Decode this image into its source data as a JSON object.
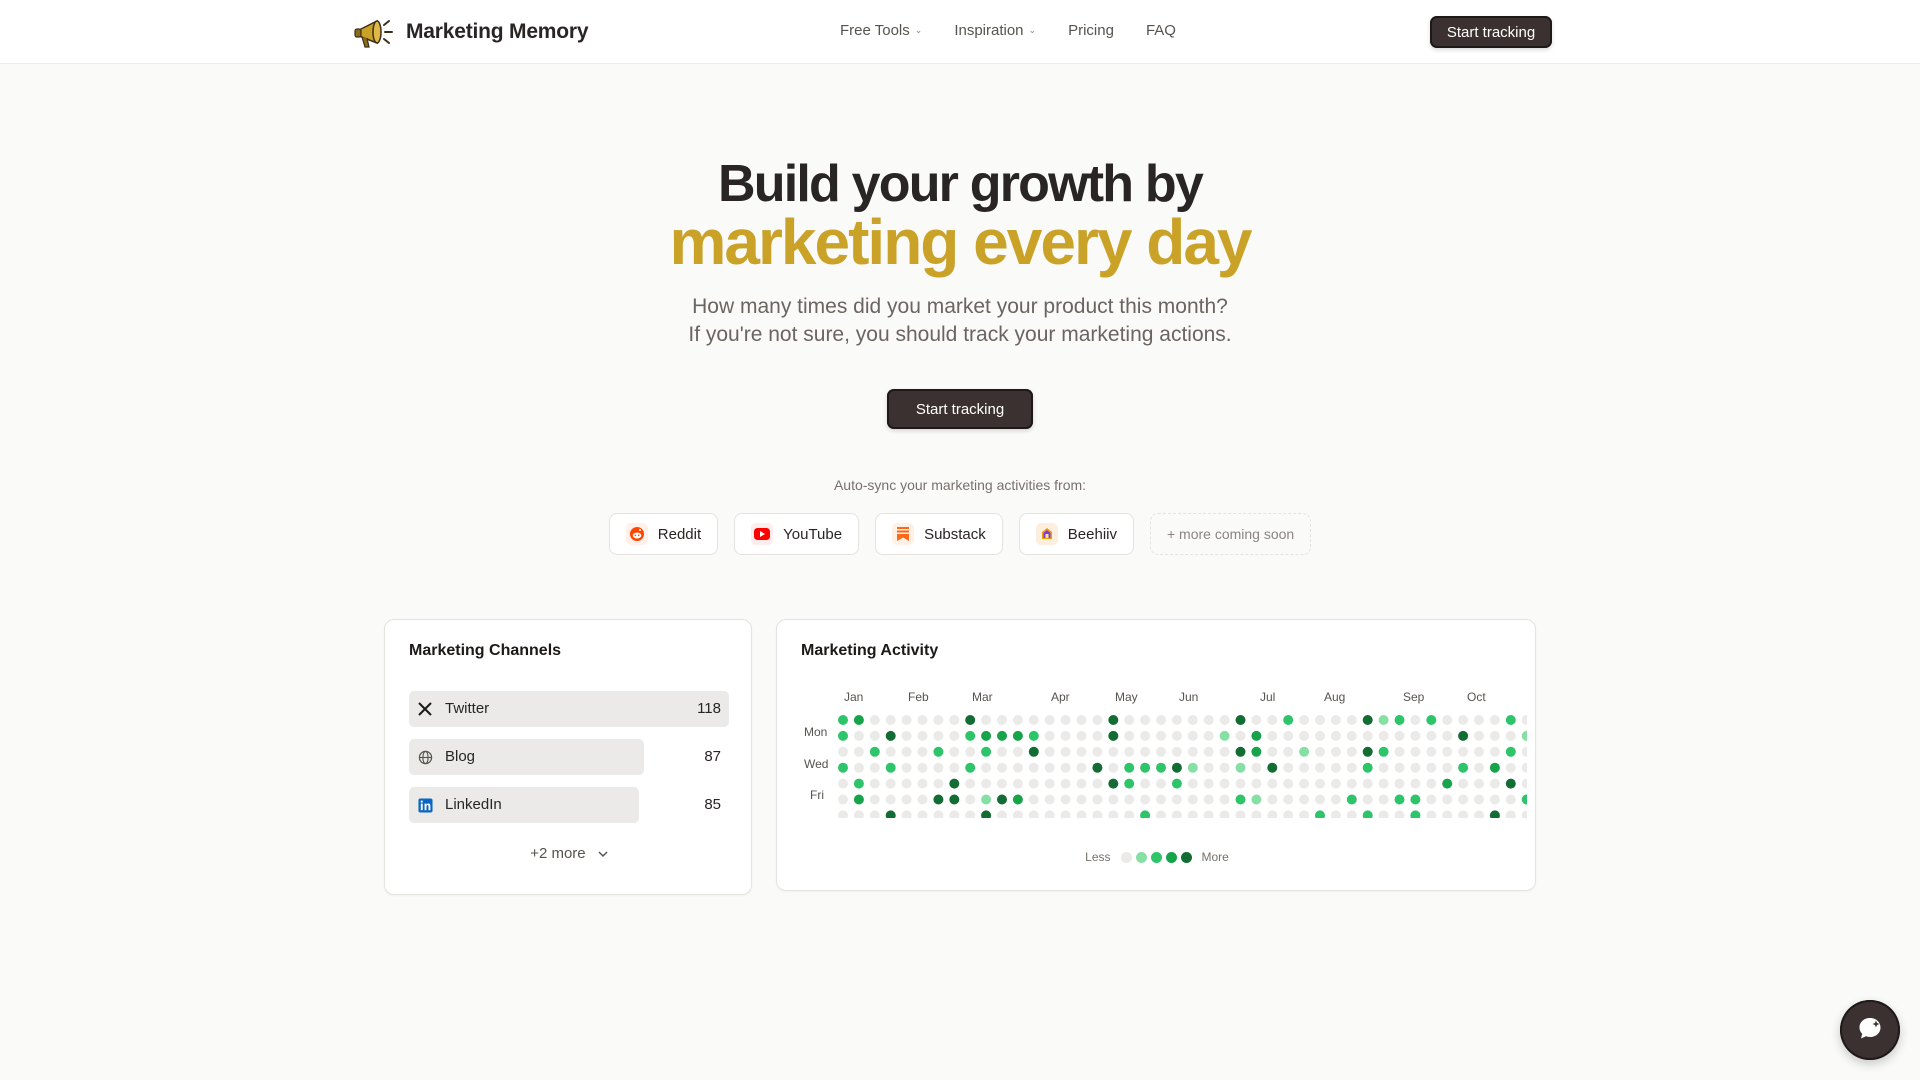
{
  "header": {
    "brand": "Marketing Memory",
    "nav": [
      {
        "label": "Free Tools",
        "dropdown": true
      },
      {
        "label": "Inspiration",
        "dropdown": true
      },
      {
        "label": "Pricing",
        "dropdown": false
      },
      {
        "label": "FAQ",
        "dropdown": false
      }
    ],
    "cta_label": "Start tracking"
  },
  "hero": {
    "title_line1": "Build your growth by",
    "title_line2": "marketing every day",
    "subtitle_line1": "How many times did you market your product this month?",
    "subtitle_line2": "If you're not sure, you should track your marketing actions.",
    "cta_label": "Start tracking",
    "accent_color": "#c9a227"
  },
  "autosync": {
    "label": "Auto-sync your marketing activities from:",
    "sources": [
      {
        "name": "Reddit",
        "icon": "reddit-icon"
      },
      {
        "name": "YouTube",
        "icon": "youtube-icon"
      },
      {
        "name": "Substack",
        "icon": "substack-icon"
      },
      {
        "name": "Beehiiv",
        "icon": "beehiiv-icon"
      }
    ],
    "more_label": "+ more coming soon"
  },
  "channels": {
    "title": "Marketing Channels",
    "items": [
      {
        "name": "Twitter",
        "count": "118",
        "icon": "x-icon"
      },
      {
        "name": "Blog",
        "count": "87",
        "icon": "globe-icon"
      },
      {
        "name": "LinkedIn",
        "count": "85",
        "icon": "linkedin-icon"
      }
    ],
    "more_label": "+2 more"
  },
  "activity": {
    "title": "Marketing Activity",
    "months": [
      "Jan",
      "Feb",
      "Mar",
      "Apr",
      "May",
      "Jun",
      "Jul",
      "Aug",
      "Sep",
      "Oct"
    ],
    "day_labels": [
      "Mon",
      "Wed",
      "Fri"
    ],
    "legend_less": "Less",
    "legend_more": "More",
    "level_colors": [
      "#ebeae8",
      "#86e0a4",
      "#2ec46a",
      "#16a34a",
      "#146c35"
    ],
    "weeks": [
      [
        2,
        2,
        0,
        2,
        0,
        0,
        0
      ],
      [
        3,
        0,
        0,
        0,
        2,
        3,
        0
      ],
      [
        0,
        0,
        2,
        0,
        0,
        0,
        0
      ],
      [
        0,
        4,
        0,
        2,
        0,
        0,
        4
      ],
      [
        0,
        0,
        0,
        0,
        0,
        0,
        0
      ],
      [
        0,
        0,
        0,
        0,
        0,
        0,
        0
      ],
      [
        0,
        0,
        2,
        0,
        0,
        4,
        0
      ],
      [
        0,
        0,
        0,
        0,
        4,
        4,
        0
      ],
      [
        4,
        2,
        0,
        2,
        0,
        0,
        0
      ],
      [
        0,
        3,
        2,
        0,
        0,
        1,
        4
      ],
      [
        0,
        3,
        0,
        0,
        0,
        4,
        0
      ],
      [
        0,
        3,
        0,
        0,
        0,
        3,
        0
      ],
      [
        0,
        2,
        4,
        0,
        0,
        0,
        0
      ],
      [
        0,
        0,
        0,
        0,
        0,
        0,
        0
      ],
      [
        0,
        0,
        0,
        0,
        0,
        0,
        0
      ],
      [
        0,
        0,
        0,
        0,
        0,
        0,
        0
      ],
      [
        0,
        0,
        0,
        4,
        0,
        0,
        0
      ],
      [
        4,
        4,
        0,
        0,
        4,
        0,
        0
      ],
      [
        0,
        0,
        0,
        2,
        2,
        0,
        0
      ],
      [
        0,
        0,
        0,
        2,
        0,
        0,
        2
      ],
      [
        0,
        0,
        0,
        2,
        0,
        0,
        0
      ],
      [
        0,
        0,
        0,
        4,
        2,
        0,
        0
      ],
      [
        0,
        0,
        0,
        1,
        0,
        0,
        0
      ],
      [
        0,
        0,
        0,
        0,
        0,
        0,
        0
      ],
      [
        0,
        1,
        0,
        0,
        0,
        0,
        0
      ],
      [
        4,
        0,
        4,
        1,
        0,
        2,
        0
      ],
      [
        0,
        3,
        3,
        0,
        0,
        1,
        0
      ],
      [
        0,
        0,
        0,
        4,
        0,
        0,
        0
      ],
      [
        2,
        0,
        0,
        0,
        0,
        0,
        0
      ],
      [
        0,
        0,
        1,
        0,
        0,
        0,
        0
      ],
      [
        0,
        0,
        0,
        0,
        0,
        0,
        2
      ],
      [
        0,
        0,
        0,
        0,
        0,
        0,
        0
      ],
      [
        0,
        0,
        0,
        0,
        0,
        2,
        0
      ],
      [
        4,
        0,
        4,
        2,
        0,
        0,
        2
      ],
      [
        1,
        0,
        2,
        0,
        0,
        0,
        0
      ],
      [
        2,
        0,
        0,
        0,
        0,
        2,
        0
      ],
      [
        0,
        0,
        0,
        0,
        0,
        2,
        2
      ],
      [
        2,
        0,
        0,
        0,
        0,
        0,
        0
      ],
      [
        0,
        0,
        0,
        0,
        3,
        0,
        0
      ],
      [
        0,
        4,
        0,
        2,
        0,
        0,
        0
      ],
      [
        0,
        0,
        0,
        0,
        0,
        0,
        0
      ],
      [
        0,
        0,
        0,
        3,
        0,
        0,
        4
      ],
      [
        2,
        0,
        2,
        0,
        4,
        0,
        0
      ],
      [
        0,
        1,
        0,
        0,
        0,
        2,
        0
      ],
      [
        0,
        0,
        0,
        0,
        0,
        0,
        0
      ]
    ]
  }
}
